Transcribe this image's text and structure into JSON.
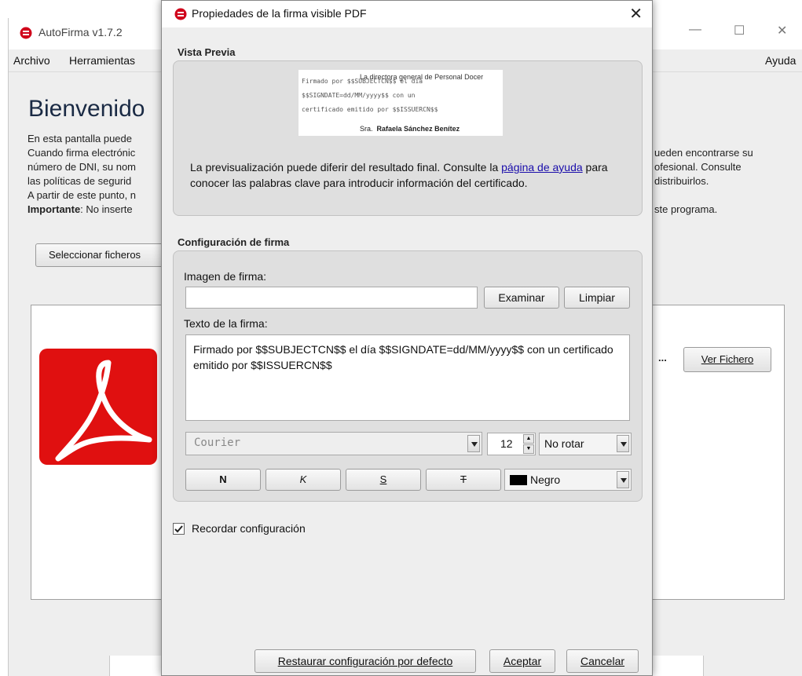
{
  "main_window": {
    "title": "AutoFirma v1.7.2",
    "menu": {
      "archivo": "Archivo",
      "herramientas": "Herramientas",
      "ayuda": "Ayuda"
    },
    "welcome": "Bienvenido",
    "intro_left": [
      "En esta pantalla puede",
      "Cuando firma electrónic",
      "número de DNI, su nom",
      "las políticas de segurid",
      "A partir de este punto, n"
    ],
    "important_label": "Importante",
    "important_rest": ": No inserte",
    "intro_right": [
      "",
      "ueden encontrarse su",
      "ofesional. Consulte",
      "distribuirlos.",
      "",
      "ste programa."
    ],
    "select_files_button": "Seleccionar ficheros",
    "file_ellipsis": "...",
    "view_file_button": "Ver Fichero"
  },
  "dialog": {
    "title": "Propiedades de la firma visible PDF",
    "preview_section": "Vista Previa",
    "preview": {
      "header": "La directora general de Personal Docer",
      "lines": [
        "Firmado por $$SUBJECTCN$$ el día",
        "$$SIGNDATE=dd/MM/yyyy$$ con un",
        "certificado emitido por $$ISSUERCN$$"
      ],
      "sign_prefix": "Sra.",
      "sign_name": "Rafaela Sánchez Benítez"
    },
    "preview_note": {
      "before": "La previsualización puede diferir del resultado final. Consulte la ",
      "link": "página de ayuda",
      "after": " para conocer las palabras clave para introducir información del certificado."
    },
    "config_section": "Configuración de firma",
    "image_label": "Imagen de firma:",
    "image_value": "",
    "examine_button": "Examinar",
    "clear_button": "Limpiar",
    "text_label": "Texto de la firma:",
    "signature_text": "Firmado por $$SUBJECTCN$$ el día $$SIGNDATE=dd/MM/yyyy$$ con un certificado emitido por $$ISSUERCN$$",
    "font": "Courier",
    "font_size": "12",
    "rotation": "No rotar",
    "style_bold": "N",
    "style_italic": "K",
    "style_underline": "S",
    "style_strike": "T",
    "color": "Negro",
    "color_swatch": "#000000",
    "remember_label": "Recordar configuración",
    "remember_checked": true,
    "restore_button": "Restaurar configuración por defecto",
    "accept_button": "Aceptar",
    "cancel_button": "Cancelar"
  }
}
